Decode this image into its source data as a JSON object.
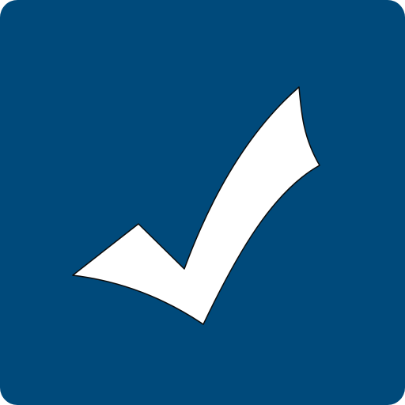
{
  "app_icon": {
    "icon": "checkmark-icon",
    "colors": {
      "background": "#004a7b",
      "mark_fill": "#ffffff",
      "mark_outline": "#0b0b0b"
    }
  }
}
